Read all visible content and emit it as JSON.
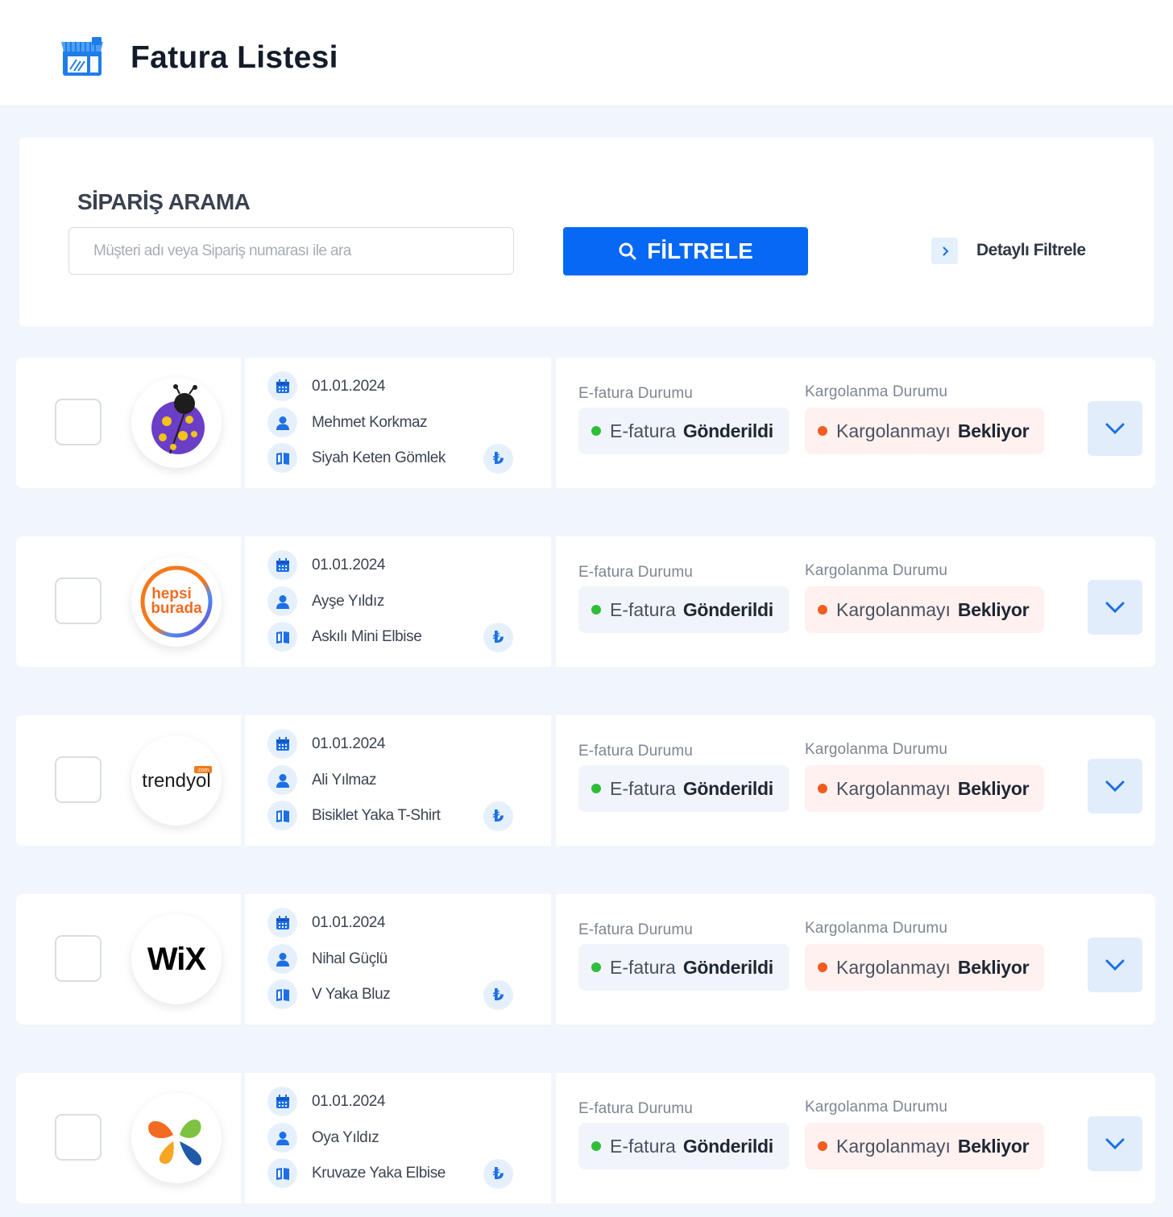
{
  "header": {
    "title": "Fatura Listesi",
    "icon": "store-invoice-icon"
  },
  "search": {
    "title": "SİPARİŞ ARAMA",
    "placeholder": "Müşteri adı veya Sipariş numarası ile ara",
    "filter_label": "FİLTRELE",
    "detail_label": "Detaylı Filtrele"
  },
  "status_labels": {
    "efatura": "E-fatura Durumu",
    "kargo": "Kargolanma Durumu"
  },
  "currency_symbol": "₺",
  "orders": [
    {
      "platform": "ladybug-logo",
      "date": "01.01.2024",
      "customer": "Mehmet Korkmaz",
      "product": "Siyah Keten Gömlek",
      "efatura_prefix": "E-fatura",
      "efatura_status": "Gönderildi",
      "kargo_prefix": "Kargolanmayı",
      "kargo_status": "Bekliyor"
    },
    {
      "platform": "hepsiburada-logo",
      "logo_text_1": "hepsi",
      "logo_text_2": "burada",
      "date": "01.01.2024",
      "customer": "Ayşe Yıldız",
      "product": "Askılı Mini Elbise",
      "efatura_prefix": "E-fatura",
      "efatura_status": "Gönderildi",
      "kargo_prefix": "Kargolanmayı",
      "kargo_status": "Bekliyor"
    },
    {
      "platform": "trendyol-logo",
      "logo_text_1": "trendyol",
      "logo_text_2": ".com",
      "date": "01.01.2024",
      "customer": "Ali Yılmaz",
      "product": "Bisiklet Yaka T-Shirt",
      "efatura_prefix": "E-fatura",
      "efatura_status": "Gönderildi",
      "kargo_prefix": "Kargolanmayı",
      "kargo_status": "Bekliyor"
    },
    {
      "platform": "wix-logo",
      "logo_text_1": "WiX",
      "date": "01.01.2024",
      "customer": "Nihal Güçlü",
      "product": "V Yaka Bluz",
      "efatura_prefix": "E-fatura",
      "efatura_status": "Gönderildi",
      "kargo_prefix": "Kargolanmayı",
      "kargo_status": "Bekliyor"
    },
    {
      "platform": "ciceksepeti-logo",
      "date": "01.01.2024",
      "customer": "Oya Yıldız",
      "product": "Kruvaze Yaka Elbise",
      "efatura_prefix": "E-fatura",
      "efatura_status": "Gönderildi",
      "kargo_prefix": "Kargolanmayı",
      "kargo_status": "Bekliyor"
    }
  ],
  "colors": {
    "primary": "#0768f5",
    "success": "#2fbd3a",
    "warning": "#f25c20",
    "background": "#f1f6fc"
  }
}
